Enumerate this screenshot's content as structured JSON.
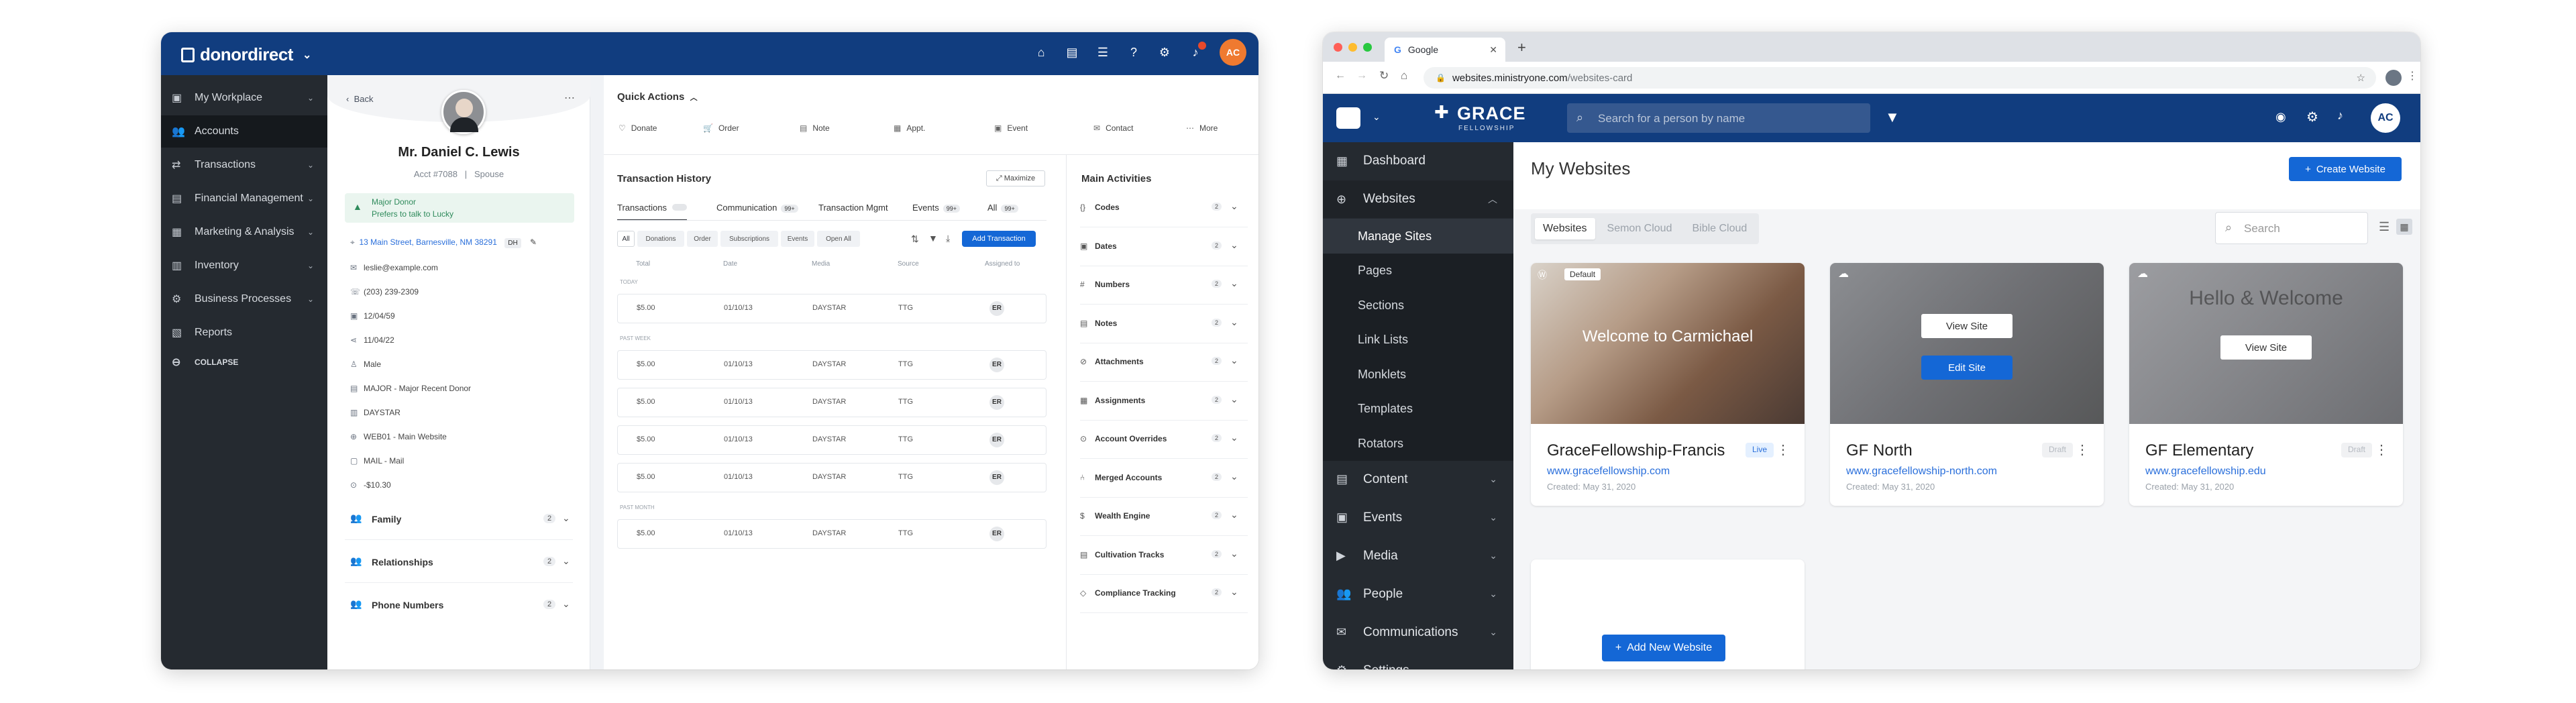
{
  "donordirect": {
    "brand": "donordirect",
    "avatar": "AC",
    "nav": [
      {
        "icon": "briefcase-icon",
        "label": "My Workplace",
        "glyph": "▣"
      },
      {
        "icon": "users-icon",
        "label": "Accounts",
        "glyph": "👥"
      },
      {
        "icon": "transactions-icon",
        "label": "Transactions",
        "glyph": "⇄"
      },
      {
        "icon": "finance-icon",
        "label": "Financial Management",
        "glyph": "▤"
      },
      {
        "icon": "marketing-icon",
        "label": "Marketing & Analysis",
        "glyph": "▦"
      },
      {
        "icon": "inventory-icon",
        "label": "Inventory",
        "glyph": "▥"
      },
      {
        "icon": "process-icon",
        "label": "Business Processes",
        "glyph": "⚙"
      },
      {
        "icon": "reports-icon",
        "label": "Reports",
        "glyph": "▧"
      },
      {
        "icon": "collapse-icon",
        "label": "COLLAPSE",
        "glyph": "⊖"
      }
    ],
    "profile": {
      "back": "Back",
      "name": "Mr. Daniel C. Lewis",
      "acct": "Acct #7088",
      "sep": "|",
      "spouse": "Spouse",
      "alert_title": "Major Donor",
      "alert_text": "Prefers to talk to Lucky",
      "address": "13 Main Street, Barnesville, NM 38291",
      "address_tag": "DH",
      "details": [
        "leslie@example.com",
        "(203) 239-2309",
        "12/04/59",
        "11/04/22",
        "Male",
        "MAJOR - Major Recent Donor",
        "DAYSTAR",
        "WEB01 - Main Website",
        "MAIL - Mail",
        "-$10.30"
      ],
      "sections": [
        {
          "label": "Family",
          "count": "2"
        },
        {
          "label": "Relationships",
          "count": "2"
        },
        {
          "label": "Phone Numbers",
          "count": "2"
        }
      ]
    },
    "quick_actions": {
      "title": "Quick Actions",
      "items": [
        "Donate",
        "Order",
        "Note",
        "Appt.",
        "Event",
        "Contact",
        "More"
      ]
    },
    "history": {
      "title": "Transaction History",
      "maximize": "Maximize",
      "tabs": [
        {
          "label": "Transactions",
          "count": ""
        },
        {
          "label": "Communication",
          "count": "99+"
        },
        {
          "label": "Transaction Mgmt",
          "count": ""
        },
        {
          "label": "Events",
          "count": "99+"
        },
        {
          "label": "All",
          "count": "99+"
        }
      ],
      "filters": [
        "All",
        "Donations",
        "Order",
        "Subscriptions",
        "Events",
        "Open All"
      ],
      "add": "Add Transaction",
      "columns": [
        "Total",
        "Date",
        "Media",
        "Source",
        "Assigned to"
      ],
      "groups": [
        {
          "label": "TODAY",
          "rows": [
            {
              "total": "$5.00",
              "date": "01/10/13",
              "media": "DAYSTAR",
              "source": "TTG",
              "assigned": "ER"
            }
          ]
        },
        {
          "label": "PAST WEEK",
          "rows": [
            {
              "total": "$5.00",
              "date": "01/10/13",
              "media": "DAYSTAR",
              "source": "TTG",
              "assigned": "ER"
            },
            {
              "total": "$5.00",
              "date": "01/10/13",
              "media": "DAYSTAR",
              "source": "TTG",
              "assigned": "ER"
            },
            {
              "total": "$5.00",
              "date": "01/10/13",
              "media": "DAYSTAR",
              "source": "TTG",
              "assigned": "ER"
            },
            {
              "total": "$5.00",
              "date": "01/10/13",
              "media": "DAYSTAR",
              "source": "TTG",
              "assigned": "ER"
            }
          ]
        },
        {
          "label": "PAST MONTH",
          "rows": [
            {
              "total": "$5.00",
              "date": "01/10/13",
              "media": "DAYSTAR",
              "source": "TTG",
              "assigned": "ER"
            }
          ]
        }
      ]
    },
    "activities": {
      "title": "Main Activities",
      "items": [
        {
          "label": "Codes",
          "count": "2"
        },
        {
          "label": "Dates",
          "count": "2"
        },
        {
          "label": "Numbers",
          "count": "2"
        },
        {
          "label": "Notes",
          "count": "2"
        },
        {
          "label": "Attachments",
          "count": "2"
        },
        {
          "label": "Assignments",
          "count": "2"
        },
        {
          "label": "Account Overrides",
          "count": "2"
        },
        {
          "label": "Merged Accounts",
          "count": "2"
        },
        {
          "label": "Wealth Engine",
          "count": "2"
        },
        {
          "label": "Cultivation Tracks",
          "count": "2"
        },
        {
          "label": "Compliance Tracking",
          "count": "2"
        }
      ]
    }
  },
  "ministry": {
    "browser_tab": "Google",
    "url_host": "websites.ministryone.com",
    "url_path": "/websites-card",
    "brand": "GRACE",
    "brand_sub": "FELLOWSHIP",
    "search_placeholder": "Search for a person by name",
    "avatar": "AC",
    "nav": [
      {
        "label": "Dashboard",
        "glyph": "▦"
      },
      {
        "label": "Websites",
        "glyph": "⊕"
      },
      {
        "label": "Content",
        "glyph": "▤"
      },
      {
        "label": "Events",
        "glyph": "▣"
      },
      {
        "label": "Media",
        "glyph": "▶"
      },
      {
        "label": "People",
        "glyph": "👥"
      },
      {
        "label": "Communications",
        "glyph": "✉"
      },
      {
        "label": "Settings",
        "glyph": "⚙"
      }
    ],
    "subnav": [
      "Manage Sites",
      "Pages",
      "Sections",
      "Link Lists",
      "Monklets",
      "Templates",
      "Rotators"
    ],
    "page_title": "My Websites",
    "create": "Create Website",
    "tabs": [
      "Websites",
      "Semon Cloud",
      "Bible Cloud"
    ],
    "search": "Search",
    "cards": [
      {
        "name": "GraceFellowship-Francis",
        "link": "www.gracefellowship.com",
        "date": "Created: May 31, 2020",
        "badge": "Live",
        "tag": "Default",
        "headline": "Welcome to Carmichael",
        "btn1": "",
        "btn2": ""
      },
      {
        "name": "GF North",
        "link": "www.gracefellowship-north.com",
        "date": "Created: May 31, 2020",
        "badge": "Draft",
        "tag": "",
        "headline": "",
        "btn1": "View Site",
        "btn2": "Edit Site"
      },
      {
        "name": "GF Elementary",
        "link": "www.gracefellowship.edu",
        "date": "Created: May 31, 2020",
        "badge": "Draft",
        "tag": "",
        "headline": "Hello & Welcome",
        "btn1": "View Site",
        "btn2": ""
      }
    ],
    "add_new": "Add New Website"
  }
}
